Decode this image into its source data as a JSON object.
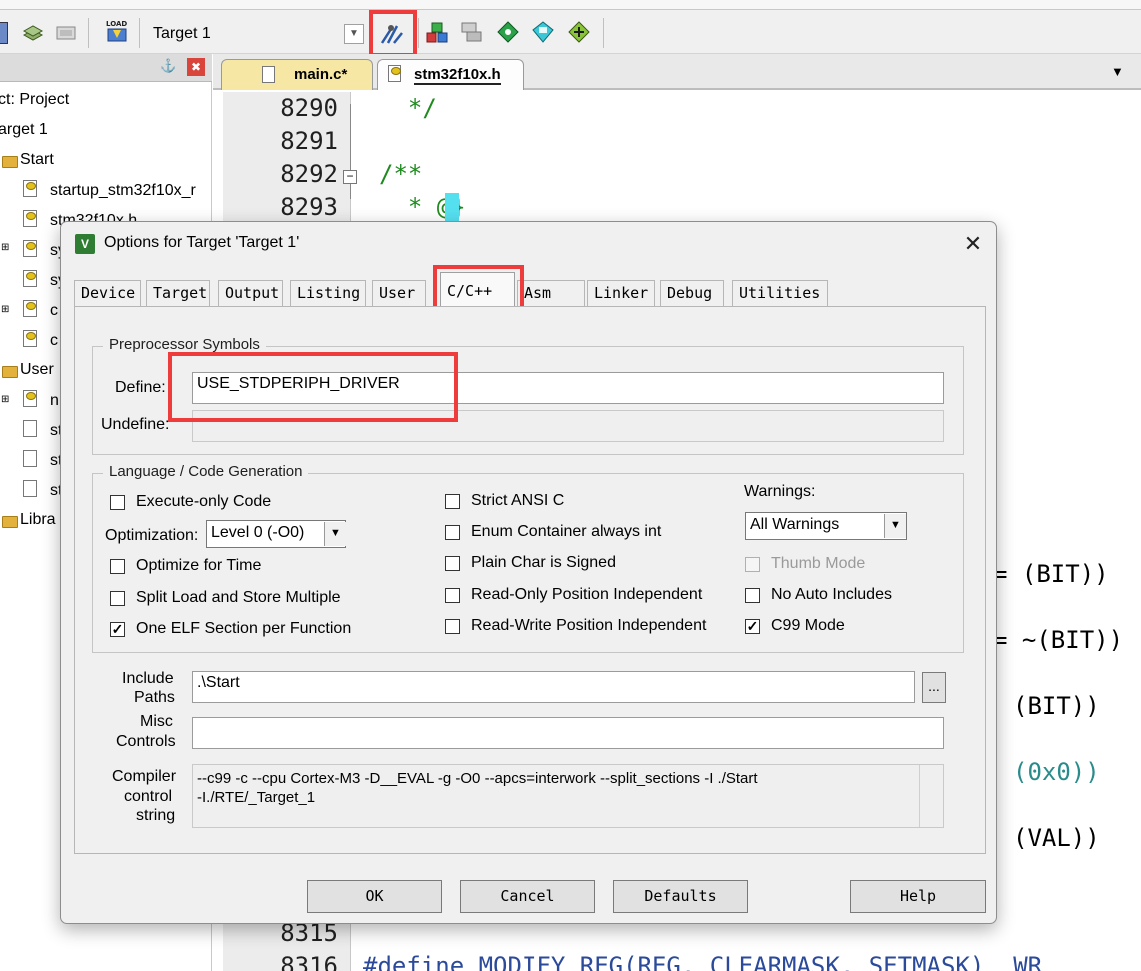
{
  "toolbar": {
    "target_name": "Target 1",
    "load_label": "LOAD"
  },
  "project": {
    "title": "ct: Project",
    "target": "arget 1",
    "groups": [
      {
        "name": "Start",
        "files": [
          "startup_stm32f10x_r",
          "stm32f10x.h",
          "sy",
          "sy",
          "c",
          "c"
        ]
      },
      {
        "name": "User",
        "files": [
          "n",
          "st",
          "st",
          "st"
        ]
      },
      {
        "name": "Libra",
        "files": []
      }
    ]
  },
  "editor": {
    "tabs": [
      "main.c*",
      "stm32f10x.h"
    ],
    "lines": [
      {
        "num": "8290",
        "code": "  */"
      },
      {
        "num": "8291",
        "code": ""
      },
      {
        "num": "8292",
        "code": "/**"
      },
      {
        "num": "8293",
        "code": "  * @}"
      },
      {
        "num": "8315",
        "code": ""
      },
      {
        "num": "8316",
        "code": "#define MODIFY_REG(REG, CLEARMASK, SETMASK)  WR"
      }
    ],
    "right_fragments": [
      "= (BIT))",
      "= ~(BIT))",
      "(BIT))",
      "(0x0))",
      "(VAL))"
    ]
  },
  "dialog": {
    "title": "Options for Target 'Target 1'",
    "close_glyph": "✕",
    "tabs": [
      "Device",
      "Target",
      "Output",
      "Listing",
      "User",
      "C/C++",
      "Asm",
      "Linker",
      "Debug",
      "Utilities"
    ],
    "active_tab": "C/C++",
    "preprocessor": {
      "legend": "Preprocessor Symbols",
      "define_label": "Define:",
      "define_value": "USE_STDPERIPH_DRIVER",
      "undefine_label": "Undefine:",
      "undefine_value": ""
    },
    "language": {
      "legend": "Language / Code Generation",
      "execute_only": {
        "label": "Execute-only Code",
        "checked": false
      },
      "optimization_label": "Optimization:",
      "optimization_value": "Level 0 (-O0)",
      "optimize_time": {
        "label": "Optimize for Time",
        "checked": false
      },
      "split_load": {
        "label": "Split Load and Store Multiple",
        "checked": false
      },
      "one_elf": {
        "label": "One ELF Section per Function",
        "checked": true
      },
      "strict_ansi": {
        "label": "Strict ANSI C",
        "checked": false
      },
      "enum_container": {
        "label": "Enum Container always int",
        "checked": false
      },
      "plain_char": {
        "label": "Plain Char is Signed",
        "checked": false
      },
      "ro_pos": {
        "label": "Read-Only Position Independent",
        "checked": false
      },
      "rw_pos": {
        "label": "Read-Write Position Independent",
        "checked": false
      },
      "warnings_label": "Warnings:",
      "warnings_value": "All Warnings",
      "thumb_mode": {
        "label": "Thumb Mode",
        "checked": false,
        "disabled": true
      },
      "no_auto_includes": {
        "label": "No Auto Includes",
        "checked": false
      },
      "c99_mode": {
        "label": "C99 Mode",
        "checked": true
      }
    },
    "include_paths_label_1": "Include",
    "include_paths_label_2": "Paths",
    "include_paths_value": ".\\Start",
    "browse_label": "...",
    "misc_label_1": "Misc",
    "misc_label_2": "Controls",
    "misc_value": "",
    "compiler_label_1": "Compiler",
    "compiler_label_2": "control",
    "compiler_label_3": "string",
    "compiler_line_1": "--c99 -c --cpu Cortex-M3 -D__EVAL -g -O0 --apcs=interwork --split_sections -I ./Start",
    "compiler_line_2": "-I./RTE/_Target_1",
    "buttons": {
      "ok": "OK",
      "cancel": "Cancel",
      "defaults": "Defaults",
      "help": "Help"
    }
  },
  "colors": {
    "highlight_red": "#ee3b3b",
    "code_green": "#1f8a1f",
    "macro_blue": "#2b4a9a",
    "teal": "#2a8b8b"
  }
}
